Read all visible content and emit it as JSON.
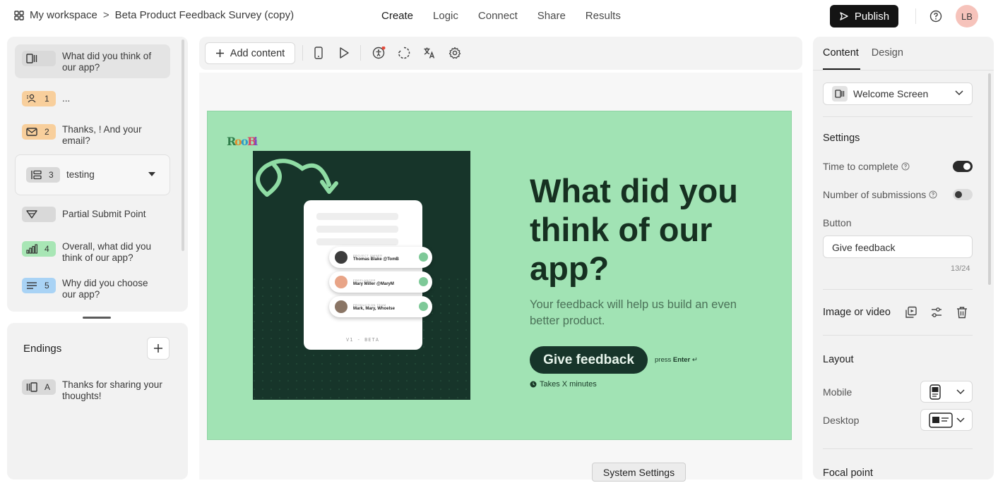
{
  "breadcrumb": {
    "workspace": "My workspace",
    "separator": ">",
    "survey": "Beta Product Feedback Survey (copy)"
  },
  "topnav": [
    "Create",
    "Logic",
    "Connect",
    "Share",
    "Results"
  ],
  "header": {
    "publish": "Publish",
    "avatar": "LB"
  },
  "questions": [
    {
      "num": "",
      "text_1": "What did you think of",
      "text_2": "our app?",
      "icon": "welcome-screen-icon",
      "color": "#d9d9d9"
    },
    {
      "num": "1",
      "text_1": "...",
      "text_2": "",
      "icon": "contact-info-icon",
      "color": "#f8cf9c"
    },
    {
      "num": "2",
      "text_1": "Thanks, ! And your",
      "text_2": "email?",
      "icon": "email-icon",
      "color": "#f8cf9c"
    },
    {
      "num": "3",
      "text_1": "testing",
      "text_2": "",
      "icon": "question-group-icon",
      "color": "#d9d9d9"
    },
    {
      "num": "",
      "text_1": "Partial Submit Point",
      "text_2": "",
      "icon": "partial-submit-icon",
      "color": "#d9d9d9"
    },
    {
      "num": "4",
      "text_1": "Overall, what did you",
      "text_2": "think of our app?",
      "icon": "rating-icon",
      "color": "#a8e6b5"
    },
    {
      "num": "5",
      "text_1": "Why did you choose",
      "text_2": "our app?",
      "icon": "long-text-icon",
      "color": "#a9d3f5"
    }
  ],
  "endings": {
    "title": "Endings",
    "item": {
      "num": "A",
      "text_1": "Thanks for sharing your",
      "text_2": "thoughts!"
    }
  },
  "toolbar": {
    "add_content": "Add content"
  },
  "slide": {
    "logo": "RooBi",
    "headline": "What did you think of our app?",
    "subline": "Your feedback will help us build an even better product.",
    "button": "Give feedback",
    "press_prefix": "press ",
    "press_key": "Enter",
    "press_symbol": "↵",
    "takes": "Takes X minutes",
    "mock": {
      "rows": [
        {
          "role": "PROJECT OWNER",
          "name": "Thomas Blake  @TomB"
        },
        {
          "role": "FREELANCER",
          "name": "Mary Miller  @MaryM"
        },
        {
          "role": "PRODUCTION TEAM",
          "name": "Mark, Mary, Whoelse"
        }
      ],
      "version": "V1 - BETA"
    },
    "bg_color": "#a1e3b4",
    "accent_color": "#17352a"
  },
  "system_settings": "System Settings",
  "right": {
    "tabs": [
      "Content",
      "Design"
    ],
    "screen_type": "Welcome Screen",
    "settings_title": "Settings",
    "time_to_complete": "Time to complete",
    "time_to_complete_on": true,
    "submissions": "Number of submissions",
    "submissions_on": false,
    "button_label": "Button",
    "button_value": "Give feedback",
    "counter": "13/24",
    "image_or_video": "Image or video",
    "layout_title": "Layout",
    "mobile": "Mobile",
    "desktop": "Desktop",
    "focal_point": "Focal point"
  }
}
